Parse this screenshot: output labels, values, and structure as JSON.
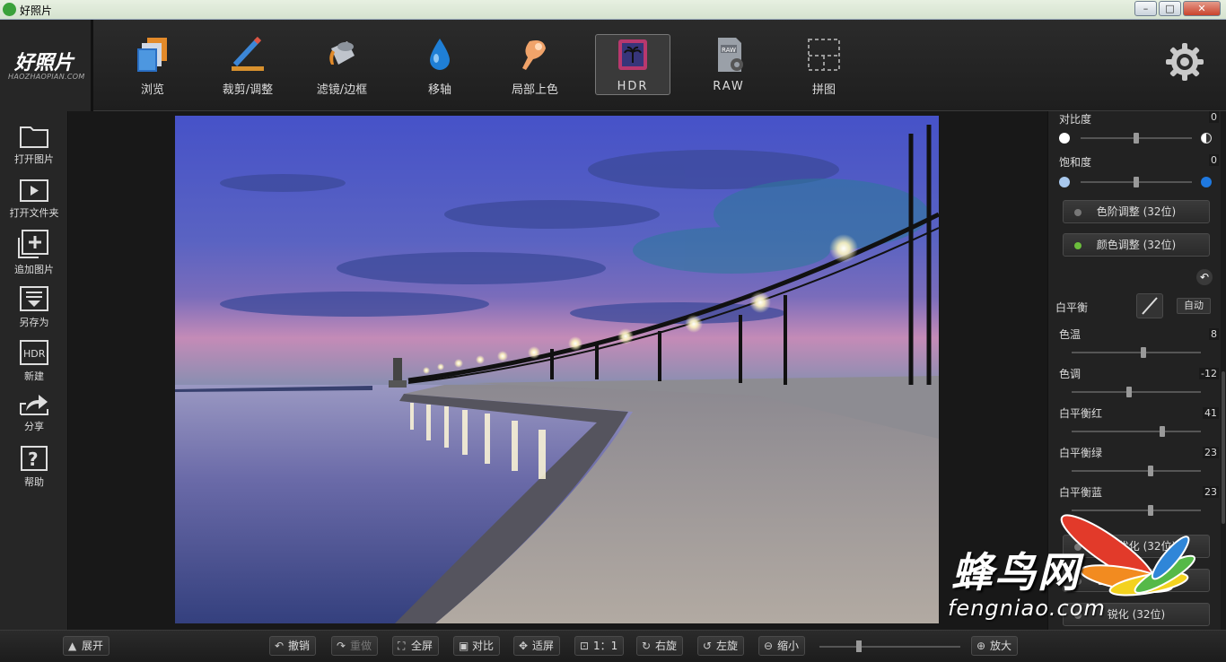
{
  "window": {
    "title": "好照片",
    "min_label": "–",
    "max_label": "□",
    "close_label": "✕"
  },
  "logo": {
    "main": "好照片",
    "sub": "HAOZHAOPIAN.COM"
  },
  "toolbar": {
    "tools": [
      {
        "label": "浏览",
        "icon": "photos-icon"
      },
      {
        "label": "裁剪/调整",
        "icon": "crop-pen-icon"
      },
      {
        "label": "滤镜/边框",
        "icon": "paint-bucket-icon"
      },
      {
        "label": "移轴",
        "icon": "water-drop-icon"
      },
      {
        "label": "局部上色",
        "icon": "brush-hand-icon"
      },
      {
        "label": "HDR",
        "icon": "hdr-palm-icon"
      },
      {
        "label": "RAW",
        "icon": "raw-file-icon"
      },
      {
        "label": "拼图",
        "icon": "collage-icon"
      }
    ],
    "active": "HDR",
    "settings_icon": "gear-icon"
  },
  "sidebar": {
    "items": [
      {
        "label": "打开图片",
        "icon": "folder-icon"
      },
      {
        "label": "打开文件夹",
        "icon": "play-folder-icon"
      },
      {
        "label": "追加图片",
        "icon": "add-image-icon"
      },
      {
        "label": "另存为",
        "icon": "save-as-icon"
      },
      {
        "label": "新建",
        "icon": "hdr-new-icon",
        "badge": "HDR"
      },
      {
        "label": "分享",
        "icon": "share-icon"
      },
      {
        "label": "帮助",
        "icon": "help-icon",
        "badge": "?"
      }
    ]
  },
  "panel": {
    "contrast": {
      "label": "对比度",
      "value": "0"
    },
    "saturation": {
      "label": "饱和度",
      "value": "0"
    },
    "levels_button": "色阶调整 (32位)",
    "color_button": "颜色调整 (32位)",
    "white_balance": {
      "label": "白平衡",
      "auto_label": "自动"
    },
    "temperature": {
      "label": "色温",
      "value": "8"
    },
    "tint": {
      "label": "色调",
      "value": "-12"
    },
    "wb_red": {
      "label": "白平衡红",
      "value": "41"
    },
    "wb_green": {
      "label": "白平衡绿",
      "value": "23"
    },
    "wb_blue": {
      "label": "白平衡蓝",
      "value": "23"
    },
    "buttons_bottom": [
      "模糊优化 (32位)",
      "色调曲线 (32位)",
      "锐化 (32位)"
    ]
  },
  "bottom": {
    "expand": "展开",
    "undo": "撤销",
    "redo": "重做",
    "fullscreen": "全屏",
    "compare": "对比",
    "fit": "适屏",
    "one_to_one": "1：1",
    "rotate_right": "右旋",
    "rotate_left": "左旋",
    "zoom_out": "缩小",
    "zoom_in": "放大"
  },
  "watermark": {
    "cn": "蜂鸟网",
    "en": "fengniao.com"
  }
}
